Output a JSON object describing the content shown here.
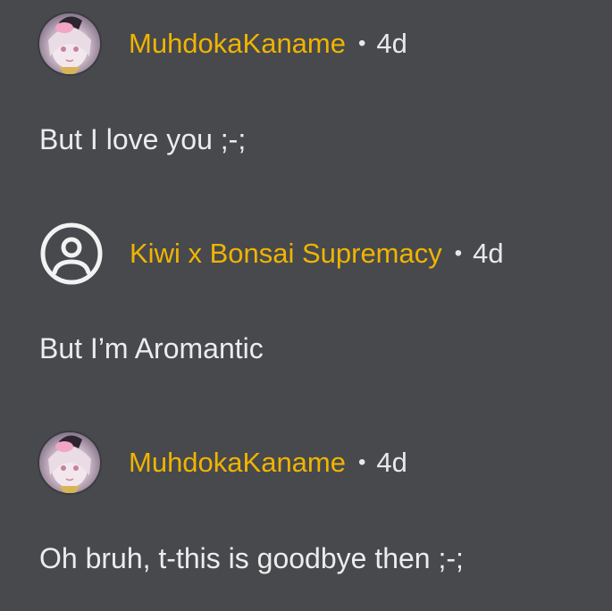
{
  "comments": [
    {
      "avatar": "anime-girl-avatar",
      "username": "MuhdokaKaname",
      "separator": "•",
      "time": "4d",
      "text": "But I love you ;-;"
    },
    {
      "avatar": "default-user-icon",
      "username": "Kiwi x Bonsai Supremacy",
      "separator": "•",
      "time": "4d",
      "text": "But I’m Aromantic"
    },
    {
      "avatar": "anime-girl-avatar",
      "username": "MuhdokaKaname",
      "separator": "•",
      "time": "4d",
      "text": "Oh bruh, t-this is goodbye then ;-;"
    }
  ],
  "colors": {
    "background": "#47494d",
    "username": "#f0b400",
    "text": "#ececec"
  }
}
